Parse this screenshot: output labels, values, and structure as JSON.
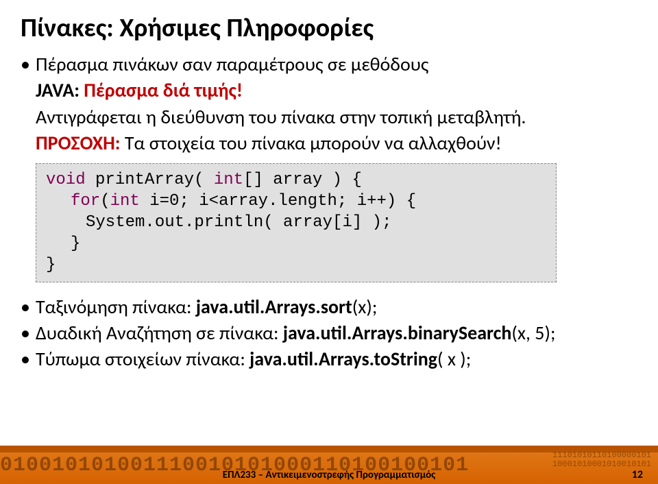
{
  "title": "Πίνακες: Χρήσιμες Πληροφορίες",
  "bullet1_line1": "Πέρασμα πινάκων σαν παραμέτρους σε μεθόδους",
  "bullet1_line2_label": "JAVA:",
  "bullet1_line2_rest": " Πέρασμα διά τιμής!",
  "bullet1_line3": "Αντιγράφεται η διεύθυνση του πίνακα στην τοπική μεταβλητή.",
  "bullet1_line4_red": "ΠΡΟΣΟΧΗ:",
  "bullet1_line4_rest": " Τα στοιχεία του πίνακα μπορούν να αλλαχθούν!",
  "code": {
    "l1_kw": "void",
    "l1_rest": "  printArray( ",
    "l1_int": "int",
    "l1_rest2": "[] array ) {",
    "l2_for": "for",
    "l2_a": "(",
    "l2_int": "int",
    "l2_b": " i=0; i<array.length; i++) {",
    "l3": "System.out.println( array[i] );",
    "l4": "}",
    "l5": "}"
  },
  "bullet2_a": "Ταξινόμηση πίνακα: ",
  "bullet2_b": "java.util.Arrays.sort",
  "bullet2_c": "(x);",
  "bullet3_a": "Δυαδική Αναζήτηση σε πίνακα: ",
  "bullet3_b": "java.util.Arrays.binarySearch",
  "bullet3_c": "(x, 5);",
  "bullet4_a": "Τύπωμα στοιχείων πίνακα: ",
  "bullet4_b": "java.util.Arrays.toString",
  "bullet4_c": "( x );",
  "footer": {
    "binary_big": "010010101001110010101000110100100101",
    "binary_small1": "11101010110100000101",
    "binary_small2": "10001010001010010101",
    "course": "ΕΠΛ233 – Αντικειμενοστρεφής Προγραμματισμός",
    "page": "12"
  }
}
